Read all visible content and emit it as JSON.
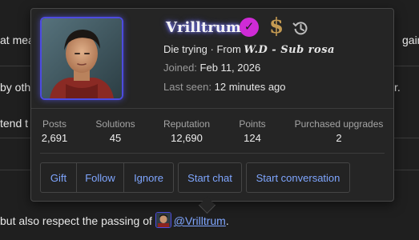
{
  "thread": {
    "line1": "at mea",
    "line1_right": "gain f",
    "line2": "by oth",
    "line2_right": "r.",
    "line3": "tend t",
    "line4_text": "but also respect the passing of ",
    "mention": "@Vrilltrum",
    "mention_after": "."
  },
  "profile": {
    "username": "Vrilltrum",
    "tagline_prefix": "Die trying · From ",
    "location": "W.D - Sub rosa",
    "joined_label": "Joined:",
    "joined_value": "Feb 11, 2026",
    "seen_label": "Last seen:",
    "seen_value": "12 minutes ago",
    "badge_dollar": "$"
  },
  "stats": [
    {
      "label": "Posts",
      "value": "2,691"
    },
    {
      "label": "Solutions",
      "value": "45"
    },
    {
      "label": "Reputation",
      "value": "12,690"
    },
    {
      "label": "Points",
      "value": "124"
    },
    {
      "label": "Purchased upgrades",
      "value": "2"
    }
  ],
  "actions": {
    "gift": "Gift",
    "follow": "Follow",
    "ignore": "Ignore",
    "start_chat": "Start chat",
    "start_conversation": "Start conversation"
  },
  "colors": {
    "accent_link": "#7fa6ff",
    "badge_check": "#cf2bd6",
    "badge_dollar": "#c49a52",
    "username_glow": "#7d7dff"
  }
}
